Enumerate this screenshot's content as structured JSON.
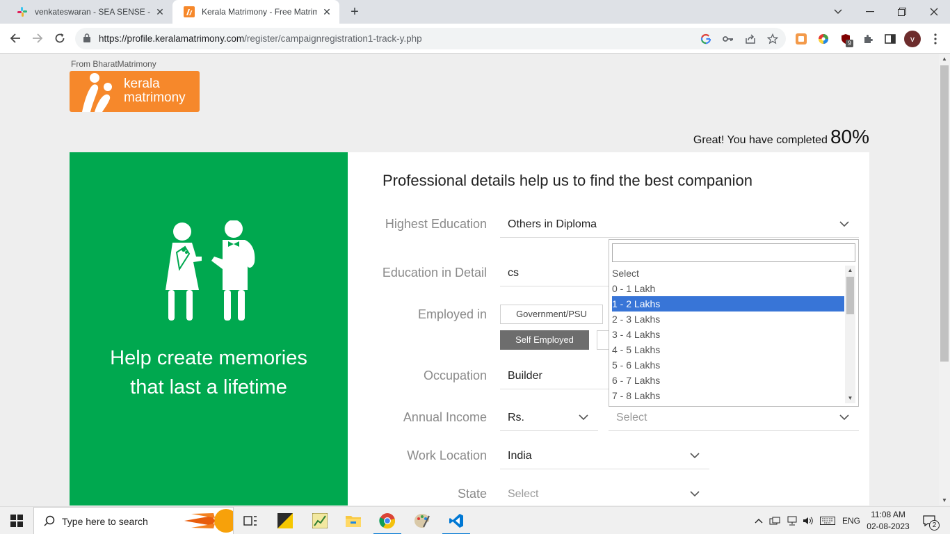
{
  "browser": {
    "tabs": [
      {
        "title": "venkateswaran - SEA SENSE - Sla",
        "active": false
      },
      {
        "title": "Kerala Matrimony - Free Matrimo",
        "active": true
      }
    ],
    "url_host": "https://profile.keralamatrimony.com",
    "url_path": "/register/campaignregistration1-track-y.php",
    "profile_initial": "v",
    "extension_badge": "9"
  },
  "page": {
    "from_label": "From BharatMatrimony",
    "logo_line1": "kerala",
    "logo_line2": "matrimony",
    "progress_text": "Great! You have completed",
    "progress_pct": "80%",
    "tagline_line1": "Help create memories",
    "tagline_line2": "that last a lifetime",
    "heading": "Professional details help us to find the best companion",
    "colors": {
      "brand_orange": "#f6882b",
      "brand_green": "#00a84f",
      "highlight": "#3875d7"
    }
  },
  "form": {
    "education_label": "Highest Education",
    "education_value": "Others in Diploma",
    "education_detail_label": "Education in Detail",
    "education_detail_value": "cs",
    "employed_label": "Employed in",
    "employed_options": [
      "Government/PSU",
      "Self Employed"
    ],
    "employed_selected": "Self Employed",
    "occupation_label": "Occupation",
    "occupation_value": "Builder",
    "income_label": "Annual Income",
    "income_currency": "Rs.",
    "income_value": "Select",
    "work_location_label": "Work Location",
    "work_location_value": "India",
    "state_label": "State",
    "state_value": "Select"
  },
  "income_dropdown": {
    "search_value": "",
    "options": [
      "Select",
      "0 - 1 Lakh",
      "1 - 2 Lakhs",
      "2 - 3 Lakhs",
      "3 - 4 Lakhs",
      "4 - 5 Lakhs",
      "5 - 6 Lakhs",
      "6 - 7 Lakhs",
      "7 - 8 Lakhs"
    ],
    "highlighted": "1 - 2 Lakhs"
  },
  "taskbar": {
    "search_placeholder": "Type here to search",
    "language": "ENG",
    "time": "11:08 AM",
    "date": "02-08-2023",
    "notification_count": "2"
  }
}
